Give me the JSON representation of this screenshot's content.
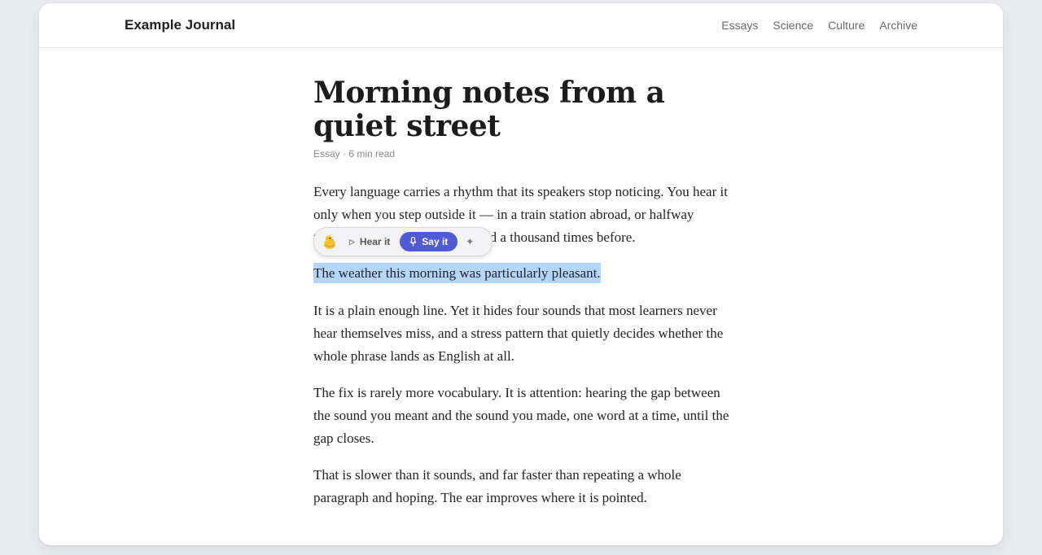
{
  "header": {
    "brand": "Example Journal",
    "nav": [
      "Essays",
      "Science",
      "Culture",
      "Archive"
    ]
  },
  "article": {
    "title": "Morning notes from a quiet street",
    "meta": "Essay · 6 min read",
    "p1": "Every language carries a rhythm that its speakers stop noticing. You hear it only when you step outside it — in a train station abroad, or halfway through a sentence you have said a thousand times before.",
    "selected_sentence": "The weather this morning was particularly pleasant.",
    "p2": "It is a plain enough line. Yet it hides four sounds that most learners never hear themselves miss, and a stress pattern that quietly decides whether the whole phrase lands as English at all.",
    "p3": "The fix is rarely more vocabulary. It is attention: hearing the gap between the sound you meant and the sound you made, one word at a time, until the gap closes.",
    "p4": "That is slower than it sounds, and far faster than repeating a whole paragraph and hoping. The ear improves where it is pointed."
  },
  "toolbar": {
    "mascot_icon": "duck-mascot-icon",
    "hear_label": "Hear it",
    "say_label": "Say it",
    "accent": "#4f5bd5",
    "selection_color": "#b4d5fe"
  }
}
